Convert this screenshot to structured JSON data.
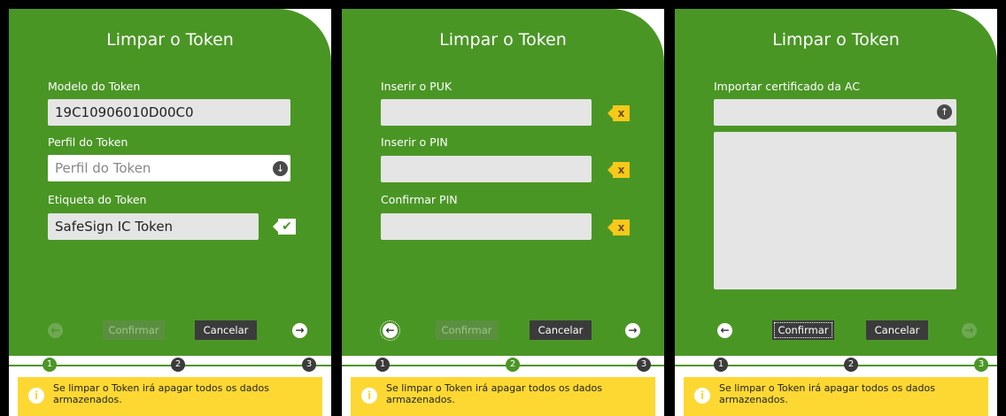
{
  "panels": [
    {
      "title": "Limpar o Token",
      "fields": [
        {
          "label": "Modelo do Token",
          "value": "19C10906010D00C0"
        },
        {
          "label": "Perfil do Token",
          "placeholder": "Perfil do Token"
        },
        {
          "label": "Etiqueta do Token",
          "value": "SafeSign IC Token"
        }
      ],
      "confirm_label": "Confirmar",
      "cancel_label": "Cancelar",
      "steps": [
        "1",
        "2",
        "3"
      ],
      "active_step": 1
    },
    {
      "title": "Limpar o Token",
      "fields": [
        {
          "label": "Inserir o PUK",
          "value": ""
        },
        {
          "label": "Inserir o PIN",
          "value": ""
        },
        {
          "label": "Confirmar PIN",
          "value": ""
        }
      ],
      "confirm_label": "Confirmar",
      "cancel_label": "Cancelar",
      "steps": [
        "1",
        "2",
        "3"
      ],
      "active_step": 2
    },
    {
      "title": "Limpar o Token",
      "fields": [
        {
          "label": "Importar certificado da AC",
          "value": ""
        }
      ],
      "confirm_label": "Confirmar",
      "cancel_label": "Cancelar",
      "steps": [
        "1",
        "2",
        "3"
      ],
      "active_step": 3
    }
  ],
  "warning_text": "Se limpar o Token irá apagar todos os dados armazenados.",
  "icons": {
    "dropdown": "chevron-down-icon",
    "upload": "upload-icon",
    "valid": "check-icon",
    "invalid": "x-icon",
    "back": "arrow-left-icon",
    "next": "arrow-right-icon",
    "info": "info-icon"
  },
  "colors": {
    "primary_green": "#4a9625",
    "warning_yellow": "#fdd832",
    "invalid_badge": "#f6c91a",
    "dark_button": "#3b3b3b"
  }
}
